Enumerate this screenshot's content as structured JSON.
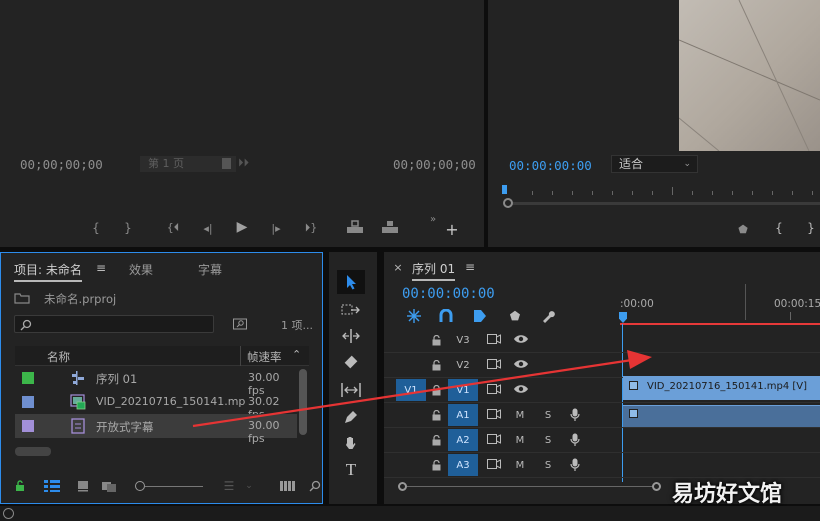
{
  "source_monitor": {
    "timecode_in": "00;00;00;00",
    "page_field": "第 1 页",
    "timecode_out": "00;00;00;00"
  },
  "program_monitor": {
    "timecode": "00:00:00:00",
    "fit_select": "适合"
  },
  "project_panel": {
    "tabs": [
      "项目: 未命名",
      "效果",
      "字幕"
    ],
    "project_file": "未命名.prproj",
    "item_count": "1 项...",
    "columns": {
      "name": "名称",
      "fps": "帧速率"
    },
    "items": [
      {
        "name": "序列 01",
        "fps": "30.00 fps",
        "color": "#3cb64a",
        "icon": "sequence-icon"
      },
      {
        "name": "VID_20210716_150141.mp",
        "fps": "30.02 fps",
        "color": "#6f8fcf",
        "icon": "video-clip-icon"
      },
      {
        "name": "开放式字幕",
        "fps": "30.00 fps",
        "color": "#a28fd8",
        "icon": "caption-icon"
      }
    ]
  },
  "tools": [
    "selection-tool-icon",
    "track-select-tool-icon",
    "ripple-edit-tool-icon",
    "razor-tool-icon",
    "slip-tool-icon",
    "pen-tool-icon",
    "hand-tool-icon",
    "type-tool-icon"
  ],
  "timeline": {
    "sequence_tab": "序列 01",
    "timecode": "00:00:00:00",
    "ruler_start": ":00:00",
    "ruler_next": "00:00:15:",
    "tracks": [
      {
        "id": "V3",
        "kind": "video"
      },
      {
        "id": "V2",
        "kind": "video"
      },
      {
        "id": "V1",
        "kind": "video",
        "source_patch": "V1"
      },
      {
        "id": "A1",
        "kind": "audio"
      },
      {
        "id": "A2",
        "kind": "audio"
      },
      {
        "id": "A3",
        "kind": "audio"
      }
    ],
    "mute_label": "M",
    "solo_label": "S",
    "clip_label": "VID_20210716_150141.mp4 [V]"
  },
  "watermark": "易坊好文馆",
  "colors": {
    "accent": "#2d8ceb",
    "timecode": "#3d9df0",
    "playhead": "#e63939",
    "clip": "#6b9fd8"
  }
}
